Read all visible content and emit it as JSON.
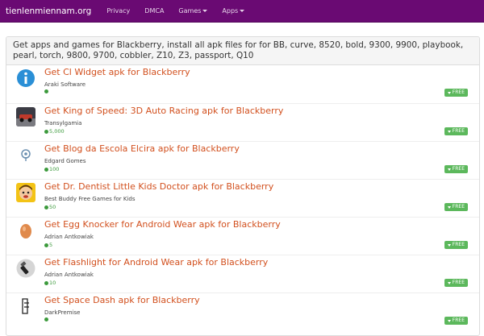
{
  "navbar": {
    "brand": "tienlenmiennam.org",
    "links": [
      "Privacy",
      "DMCA",
      "Games",
      "Apps"
    ],
    "bg_color": "#6a0a73"
  },
  "panel": {
    "heading": "Get apps and games for Blackberry, install all apk files for for BB, curve, 8520, bold, 9300, 9900, playbook, pearl, torch, 9800, 9700, cobbler, Z10, Z3, passport, Q10"
  },
  "apps": [
    {
      "title": "Get Cl Widget apk for Blackberry",
      "developer": "Araki Software",
      "downloads": "",
      "badge": "FREE",
      "icon": "info-icon"
    },
    {
      "title": "Get King of Speed: 3D Auto Racing apk for Blackberry",
      "developer": "Transylgamia",
      "downloads": "5,000",
      "badge": "FREE",
      "icon": "race-car-icon"
    },
    {
      "title": "Get Blog da Escola Elcira apk for Blackberry",
      "developer": "Edgard Gomes",
      "downloads": "100",
      "badge": "FREE",
      "icon": "blog-logo-icon"
    },
    {
      "title": "Get Dr. Dentist Little Kids Doctor apk for Blackberry",
      "developer": "Best Buddy Free Games for Kids",
      "downloads": "50",
      "badge": "FREE",
      "icon": "kid-face-icon"
    },
    {
      "title": "Get Egg Knocker for Android Wear apk for Blackberry",
      "developer": "Adrian Antkowiak",
      "downloads": "5",
      "badge": "FREE",
      "icon": "egg-icon"
    },
    {
      "title": "Get Flashlight for Android Wear apk for Blackberry",
      "developer": "Adrian Antkowiak",
      "downloads": "10",
      "badge": "FREE",
      "icon": "flashlight-icon"
    },
    {
      "title": "Get Space Dash apk for Blackberry",
      "developer": "DarkPremise",
      "downloads": "",
      "badge": "FREE",
      "icon": "space-dash-icon"
    }
  ]
}
